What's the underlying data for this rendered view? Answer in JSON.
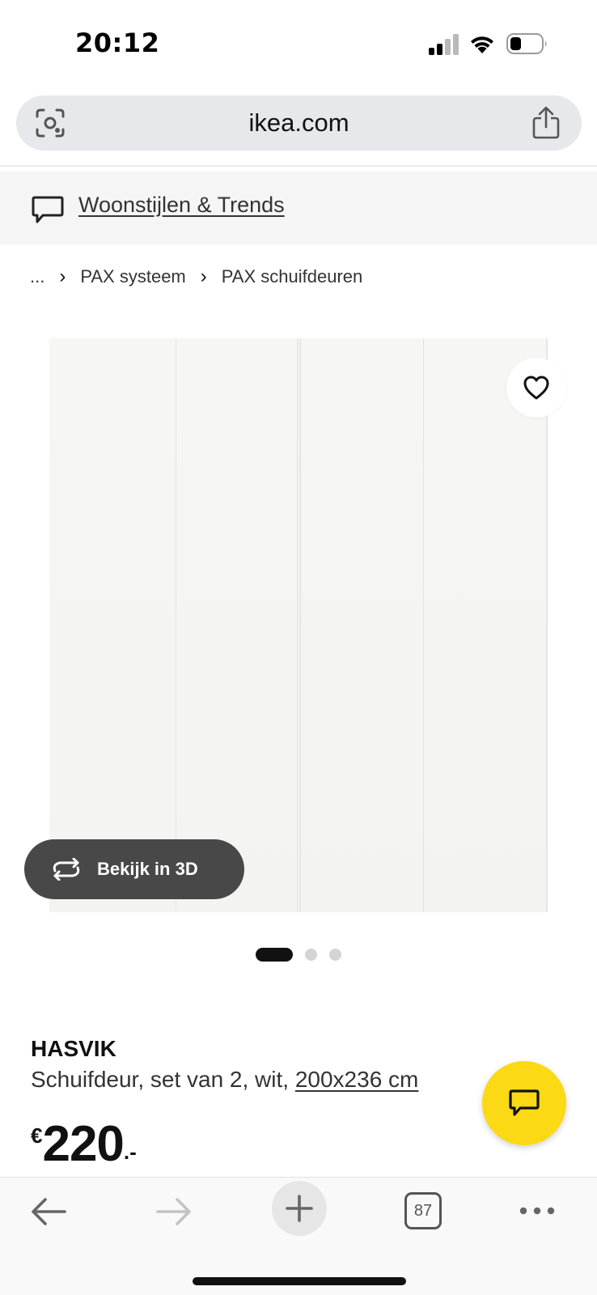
{
  "status_bar": {
    "time": "20:12"
  },
  "browser": {
    "url": "ikea.com",
    "tab_count": "87"
  },
  "banner": {
    "link_text": "Woonstijlen & Trends"
  },
  "breadcrumb": {
    "items": [
      "...",
      "PAX systeem",
      "PAX schuifdeuren"
    ]
  },
  "gallery": {
    "view_3d_label": "Bekijk in 3D",
    "image_count": 3,
    "active_index": 0
  },
  "product": {
    "name": "HASVIK",
    "description": "Schuifdeur, set van 2, wit, ",
    "size": "200x236 cm",
    "currency": "€",
    "price": "220",
    "price_suffix": ".-"
  },
  "colors": {
    "accent_yellow": "#fbd914",
    "button_dark": "#484848"
  },
  "icons": {
    "lens": "camera-lens-icon",
    "share": "share-icon",
    "chat": "chat-icon",
    "favorite": "heart-icon",
    "rotate": "rotate-3d-icon"
  }
}
